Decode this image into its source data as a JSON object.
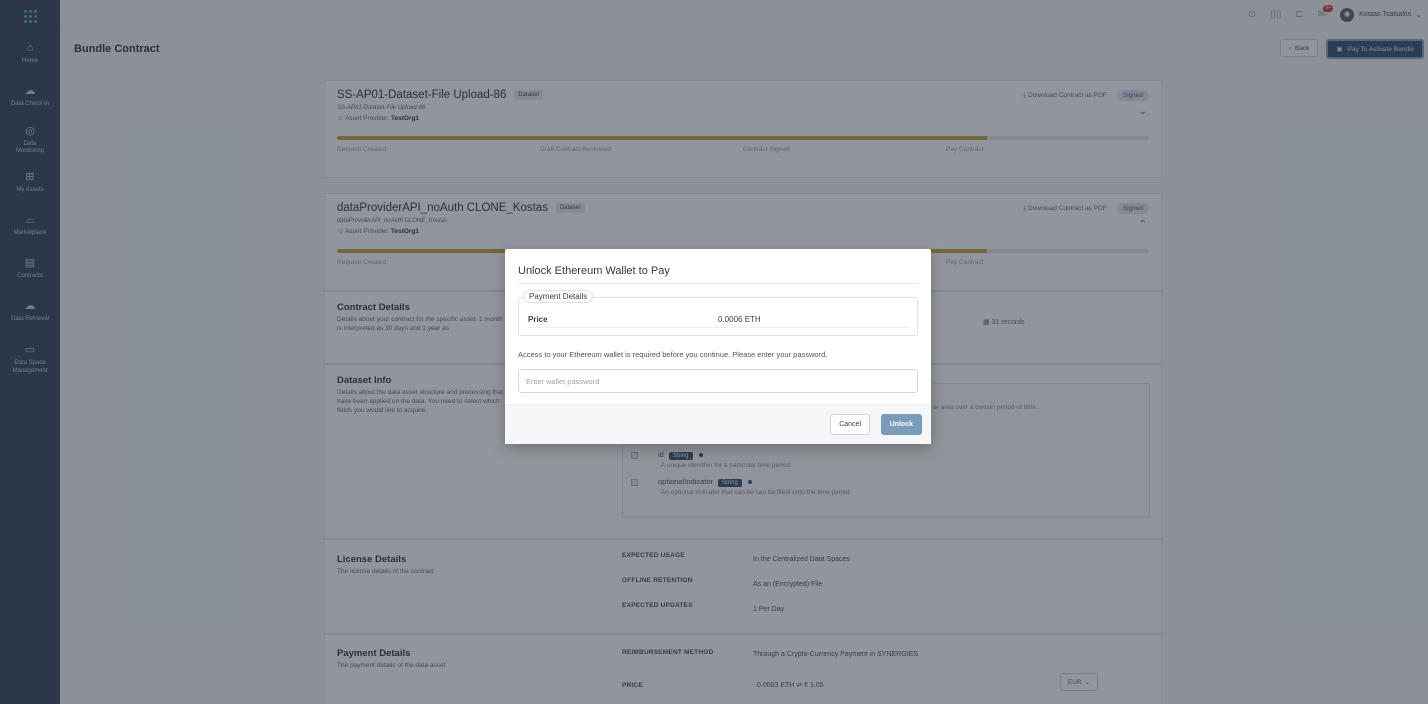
{
  "sidebar": {
    "items": [
      {
        "label": "Home",
        "icon": "home-icon"
      },
      {
        "label": "Data Check-in",
        "icon": "cloud-upload-icon"
      },
      {
        "label": "Data Monitoring",
        "icon": "monitor-icon"
      },
      {
        "label": "My Assets",
        "icon": "grid-icon"
      },
      {
        "label": "Marketplace",
        "icon": "bag-icon"
      },
      {
        "label": "Contracts",
        "icon": "clipboard-icon"
      },
      {
        "label": "Data Retrieval",
        "icon": "cloud-download-icon"
      },
      {
        "label": "Data Space Management",
        "icon": "database-icon"
      }
    ]
  },
  "topbar": {
    "notification_count": "9+",
    "user_name": "Kostas Tsatsakis"
  },
  "header": {
    "title": "Bundle Contract",
    "back_label": "Back",
    "pay_label": "Pay To Activate Bundle"
  },
  "assets": [
    {
      "title": "SS-AP01-Dataset-File Upload-86",
      "tag": "Dataset",
      "subtitle": "SS-AP01-Dataset-File Upload-86",
      "provider_label": "Asset Provider:",
      "provider": "TestOrg1",
      "download_label": "Download Contract as PDF",
      "status": "Signed",
      "progress": 0.8
    },
    {
      "title": "dataProviderAPI_noAuth CLONE_Kostas",
      "tag": "Dataset",
      "subtitle": "dataProviderAPI_noAuth CLONE_Kostas",
      "provider_label": "Asset Provider:",
      "provider": "TestOrg1",
      "download_label": "Download Contract as PDF",
      "status": "Signed",
      "progress": 0.8
    }
  ],
  "steps": [
    "Request Created",
    "Draft Contract Reviewed",
    "Contract Signed",
    "Pay Contract"
  ],
  "contract_details": {
    "title": "Contract Details",
    "description": "Details about your contract for the specific asset. 1 month is interpreted as 30 days and 1 year as",
    "records": "31 records"
  },
  "dataset_info": {
    "title": "Dataset Info",
    "description": "Details about the data asset structure and processing that have been applied on the data. You need to select which fields you would like to acquire.",
    "top_desc": "or area over a certain period of time.",
    "fields": [
      {
        "name": "id",
        "type": "String",
        "desc": "A unique identifier for a particular time period."
      },
      {
        "name": "optionalIndicator",
        "type": "String",
        "desc": "An optional indicator that can be can be filled onto the time period."
      }
    ]
  },
  "license": {
    "title": "License Details",
    "description": "The license details of the contract",
    "rows": [
      {
        "label": "EXPECTED USAGE",
        "value": "In the Centralized Data Spaces"
      },
      {
        "label": "OFFLINE RETENTION",
        "value": "As an (Encrypted) File"
      },
      {
        "label": "EXPECTED UPDATES",
        "value": "1 Per Day"
      }
    ]
  },
  "payment": {
    "title": "Payment Details",
    "description": "The payment details of the data asset",
    "method_label": "REIMBURSEMENT METHOD",
    "method_value": "Through a Crypto-Currency Payment in SYNERGIES",
    "price_label": "PRICE",
    "price_value": "0.0003 ETH ⇄ € 1.05",
    "currency": "EUR"
  },
  "modal": {
    "title": "Unlock Ethereum Wallet to Pay",
    "legend": "Payment Details",
    "price_label": "Price",
    "price_value": "0.0006 ETH",
    "message": "Access to your Ethereum wallet is required before you continue. Please enter your password.",
    "password_placeholder": "Enter wallet password",
    "cancel_label": "Cancel",
    "unlock_label": "Unlock"
  }
}
